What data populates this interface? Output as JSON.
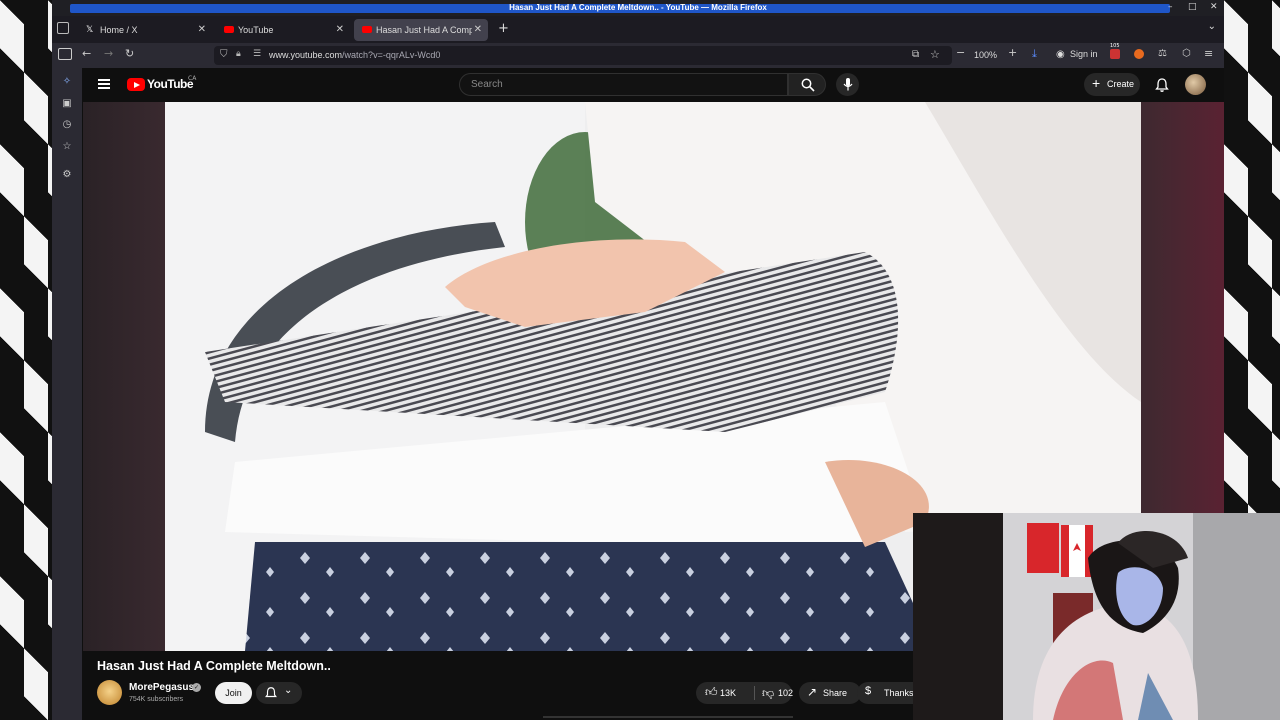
{
  "window": {
    "title": "Hasan Just Had A Complete Meltdown.. - YouTube — Mozilla Firefox"
  },
  "tabs": [
    {
      "label": "Home / X",
      "icon": "x-logo-icon",
      "active": false
    },
    {
      "label": "YouTube",
      "icon": "youtube-favicon-icon",
      "active": false
    },
    {
      "label": "Hasan Just Had A Complete Meltdown..",
      "icon": "youtube-favicon-icon",
      "active": true
    }
  ],
  "navbar": {
    "url_prefix": "www.youtube.com",
    "url_path": "/watch?v=-qqrALv-Wcd0",
    "zoom": "100%",
    "signin": "Sign in",
    "badge": "105"
  },
  "youtube": {
    "logo_text": "YouTube",
    "country": "CA",
    "search_placeholder": "Search",
    "create_label": "Create"
  },
  "video": {
    "title": "Hasan Just Had A Complete Meltdown..",
    "channel_name": "MorePegasus",
    "subscribers": "754K subscribers",
    "join_label": "Join",
    "likes": "13K",
    "dislikes": "102",
    "share_label": "Share",
    "thanks_label": "Thanks"
  },
  "colors": {
    "yt_red": "#ff0000",
    "firefox_blue": "#1f56c8"
  }
}
